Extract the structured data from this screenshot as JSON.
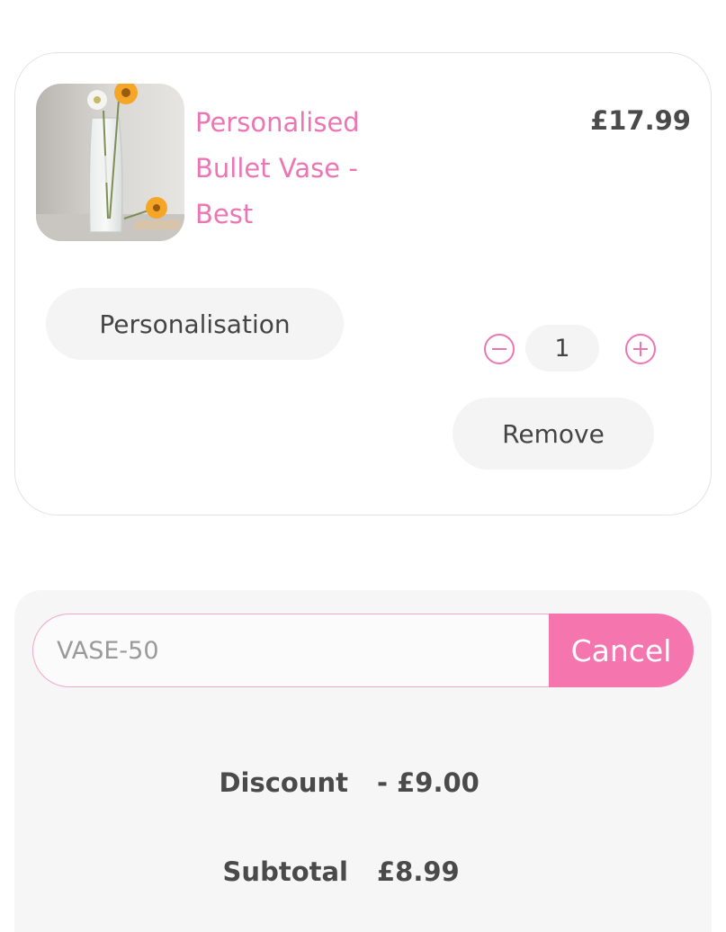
{
  "cart_item": {
    "image_alt": "Personalised glass bullet vase with daisies",
    "title": "Personalised Bullet Vase - Best",
    "price": "£17.99",
    "personalisation_label": "Personalisation",
    "quantity": "1",
    "remove_label": "Remove"
  },
  "summary": {
    "coupon_code": "VASE-50",
    "cancel_label": "Cancel",
    "discount_label": "Discount",
    "discount_value": "- £9.00",
    "subtotal_label": "Subtotal",
    "subtotal_value": "£8.99"
  },
  "colors": {
    "accent_pink": "#f576ae",
    "title_pink": "#ec76b3",
    "pill_bg": "#f4f4f4",
    "summary_bg": "#f6f6f6"
  },
  "icons": {
    "decrease": "minus-circle-icon",
    "increase": "plus-circle-icon"
  }
}
